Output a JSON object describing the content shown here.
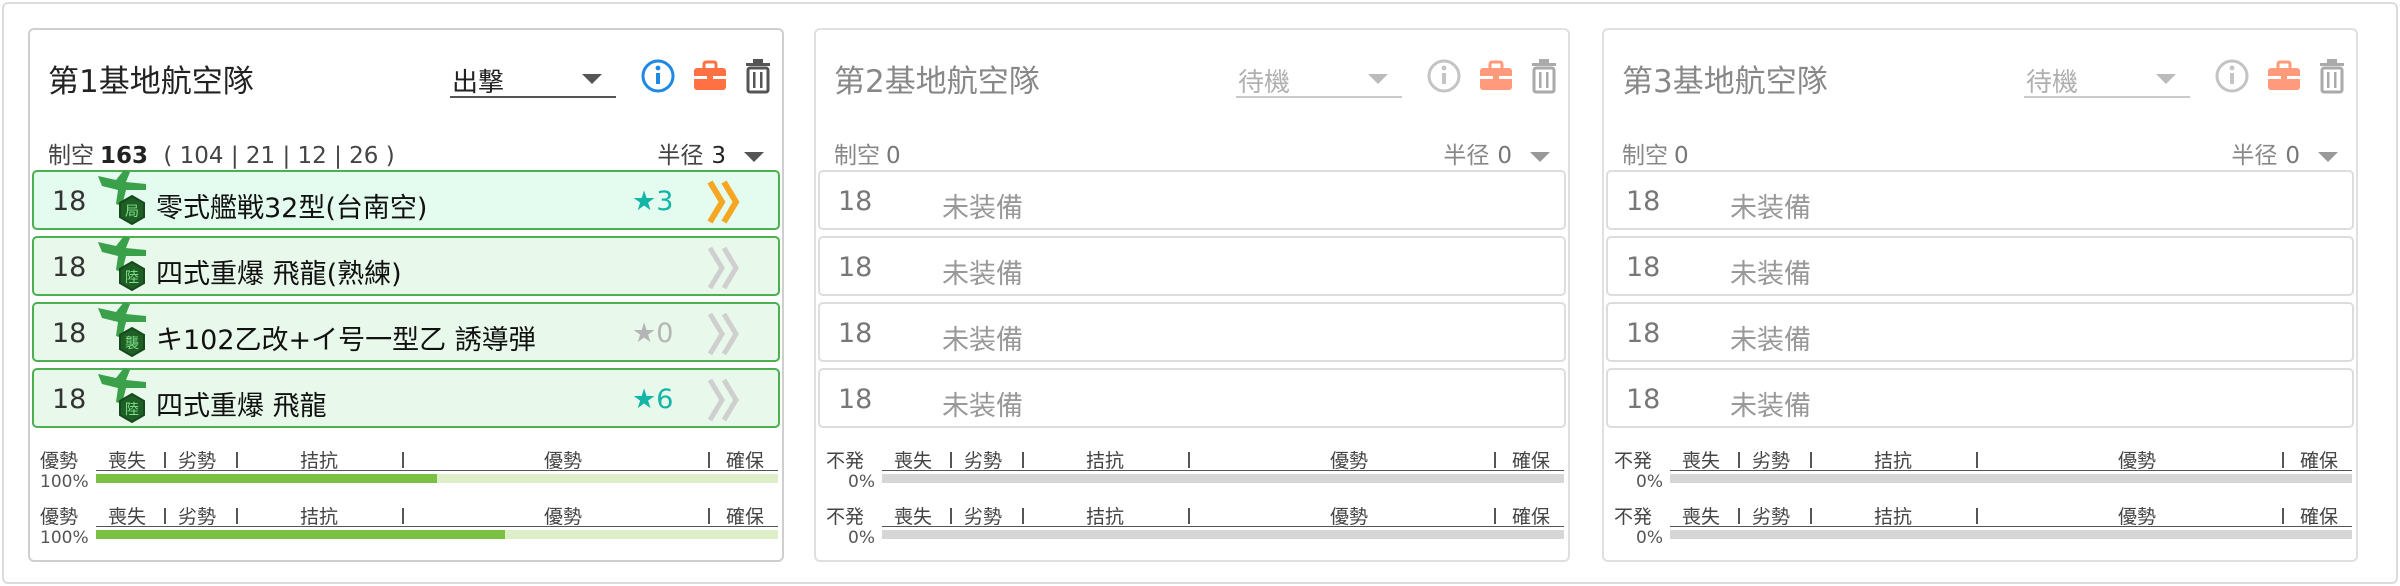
{
  "labels": {
    "air_label": "制空",
    "radius_label": "半径"
  },
  "gauge_scale": [
    "喪失",
    "劣勢",
    "拮抗",
    "優勢",
    "確保"
  ],
  "panels": [
    {
      "title": "第1基地航空隊",
      "status": "出撃",
      "air_power_value": "163",
      "air_power_detail": "( 104 | 21 | 12 | 26 )",
      "radius_value": "3",
      "slots": [
        {
          "count": "18",
          "name": "零式艦戦32型(台南空)",
          "badge": "局",
          "star": "★3",
          "star_color": "c",
          "proficiency": "high"
        },
        {
          "count": "18",
          "name": "四式重爆 飛龍(熟練)",
          "badge": "陸",
          "star": "",
          "star_color": "",
          "proficiency": "low"
        },
        {
          "count": "18",
          "name": "キ102乙改+イ号一型乙 誘導弾",
          "badge": "襲",
          "star": "★0",
          "star_color": "g",
          "proficiency": "low"
        },
        {
          "count": "18",
          "name": "四式重爆 飛龍",
          "badge": "陸",
          "star": "★6",
          "star_color": "c",
          "proficiency": "low"
        }
      ],
      "gauges": [
        {
          "status": "優勢",
          "percent": "100%",
          "fill": 0.5
        },
        {
          "status": "優勢",
          "percent": "100%",
          "fill": 0.6
        }
      ]
    },
    {
      "title": "第2基地航空隊",
      "status": "待機",
      "air_power_value": "0",
      "air_power_detail": "",
      "radius_value": "0",
      "slots": [
        {
          "count": "18",
          "empty": "未装備"
        },
        {
          "count": "18",
          "empty": "未装備"
        },
        {
          "count": "18",
          "empty": "未装備"
        },
        {
          "count": "18",
          "empty": "未装備"
        }
      ],
      "gauges": [
        {
          "status": "不発",
          "percent": "0%",
          "fill": 0
        },
        {
          "status": "不発",
          "percent": "0%",
          "fill": 0
        }
      ]
    },
    {
      "title": "第3基地航空隊",
      "status": "待機",
      "air_power_value": "0",
      "air_power_detail": "",
      "radius_value": "0",
      "slots": [
        {
          "count": "18",
          "empty": "未装備"
        },
        {
          "count": "18",
          "empty": "未装備"
        },
        {
          "count": "18",
          "empty": "未装備"
        },
        {
          "count": "18",
          "empty": "未装備"
        }
      ],
      "gauges": [
        {
          "status": "不発",
          "percent": "0%",
          "fill": 0
        },
        {
          "status": "不発",
          "percent": "0%",
          "fill": 0
        }
      ]
    }
  ],
  "icons": [
    "info-icon",
    "briefcase-icon",
    "trash-icon",
    "plane-icon",
    "proficiency-chevron-icon"
  ],
  "colors": {
    "equipped_border": "#4caf50",
    "equipped_bg": "#e8f8ea",
    "star_cyan": "#12b5a6",
    "gauge_fill": "#7ac043",
    "info_blue": "#1e88e5",
    "briefcase_orange": "#ff7043",
    "chevron_gold": "#f5a623"
  }
}
